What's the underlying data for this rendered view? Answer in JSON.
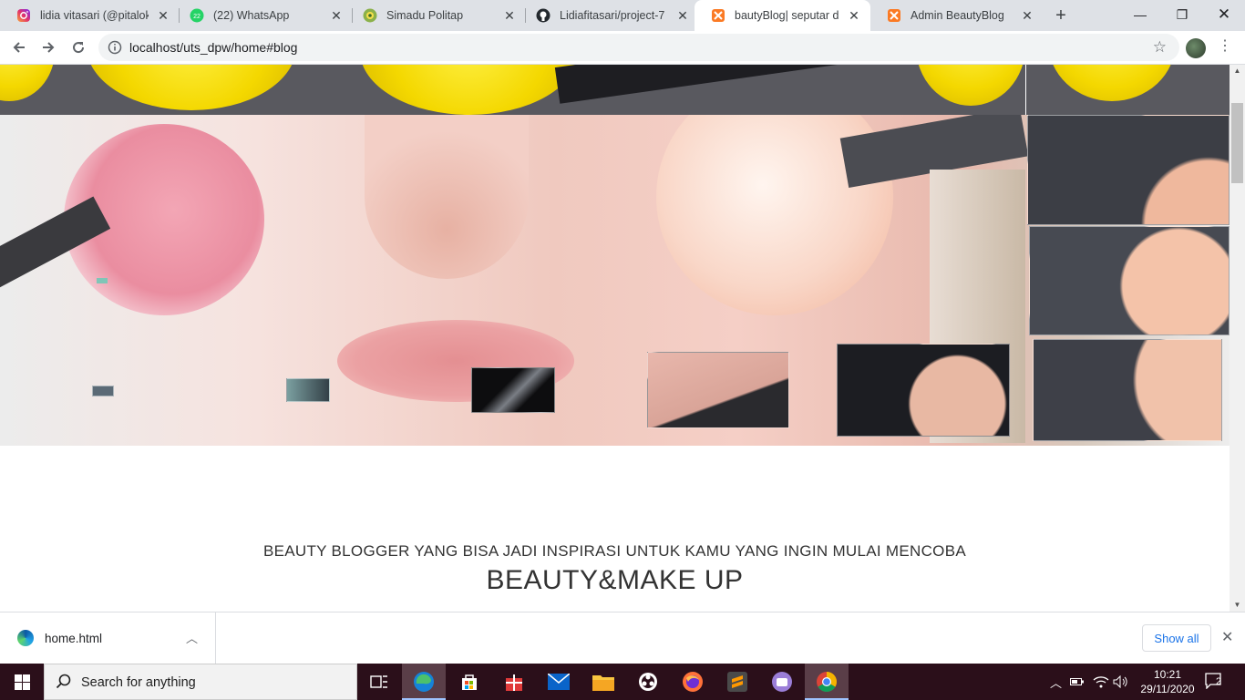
{
  "browser": {
    "tabs": [
      {
        "title": "lidia vitasari (@pitaloka",
        "icon": "instagram-icon",
        "active": false
      },
      {
        "title": "(22) WhatsApp",
        "icon": "whatsapp-icon",
        "badge": "22",
        "active": false
      },
      {
        "title": "Simadu Politap",
        "icon": "politap-logo-icon",
        "active": false
      },
      {
        "title": "Lidiafitasari/project-7",
        "icon": "github-icon",
        "active": false
      },
      {
        "title": "bautyBlog| seputar dun",
        "icon": "xampp-icon",
        "active": true
      },
      {
        "title": "Admin BeautyBlog",
        "icon": "xampp-icon",
        "active": false
      }
    ],
    "new_tab_symbol": "+",
    "url": "localhost/uts_dpw/home#blog",
    "window_controls": {
      "minimize": "—",
      "restore": "❐",
      "close": "✕"
    }
  },
  "page": {
    "hero_alt": "",
    "subheadline": "BEAUTY BLOGGER YANG BISA JADI INSPIRASI UNTUK KAMU YANG INGIN MULAI MENCOBA",
    "headline": "BEAUTY&MAKE UP"
  },
  "downloads": {
    "file_name": "home.html",
    "show_all_label": "Show all"
  },
  "taskbar": {
    "search_placeholder": "Search for anything",
    "pinned": [
      "task-view-icon",
      "edge-icon",
      "store-icon",
      "gift-icon",
      "mail-icon",
      "file-explorer-icon",
      "obs-icon",
      "firefox-icon",
      "sublime-text-icon",
      "app-icon",
      "chrome-icon"
    ],
    "time": "10:21",
    "date": "29/11/2020",
    "notification_count": "2"
  },
  "colors": {
    "tabstrip_bg": "#dee1e6",
    "taskbar_bg": "#2b0f1a",
    "link_blue": "#1a73e8"
  }
}
